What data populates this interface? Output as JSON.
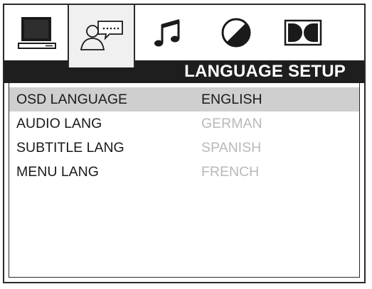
{
  "tabs": [
    {
      "id": "general",
      "icon": "monitor-icon"
    },
    {
      "id": "language",
      "icon": "person-speech-icon",
      "active": true
    },
    {
      "id": "audio",
      "icon": "music-note-icon"
    },
    {
      "id": "video",
      "icon": "contrast-circle-icon"
    },
    {
      "id": "dolby",
      "icon": "dolby-icon"
    }
  ],
  "header": {
    "title": "LANGUAGE SETUP"
  },
  "menu": {
    "items": [
      {
        "label": "OSD LANGUAGE",
        "value": "ENGLISH",
        "selected": true
      },
      {
        "label": "AUDIO LANG",
        "value": "GERMAN"
      },
      {
        "label": "SUBTITLE LANG",
        "value": "SPANISH"
      },
      {
        "label": "MENU LANG",
        "value": "FRENCH"
      }
    ]
  },
  "colors": {
    "selected_row": "#cfcfcf",
    "inactive_value": "#b9b9b9",
    "title_bar": "#1e1e1e"
  }
}
